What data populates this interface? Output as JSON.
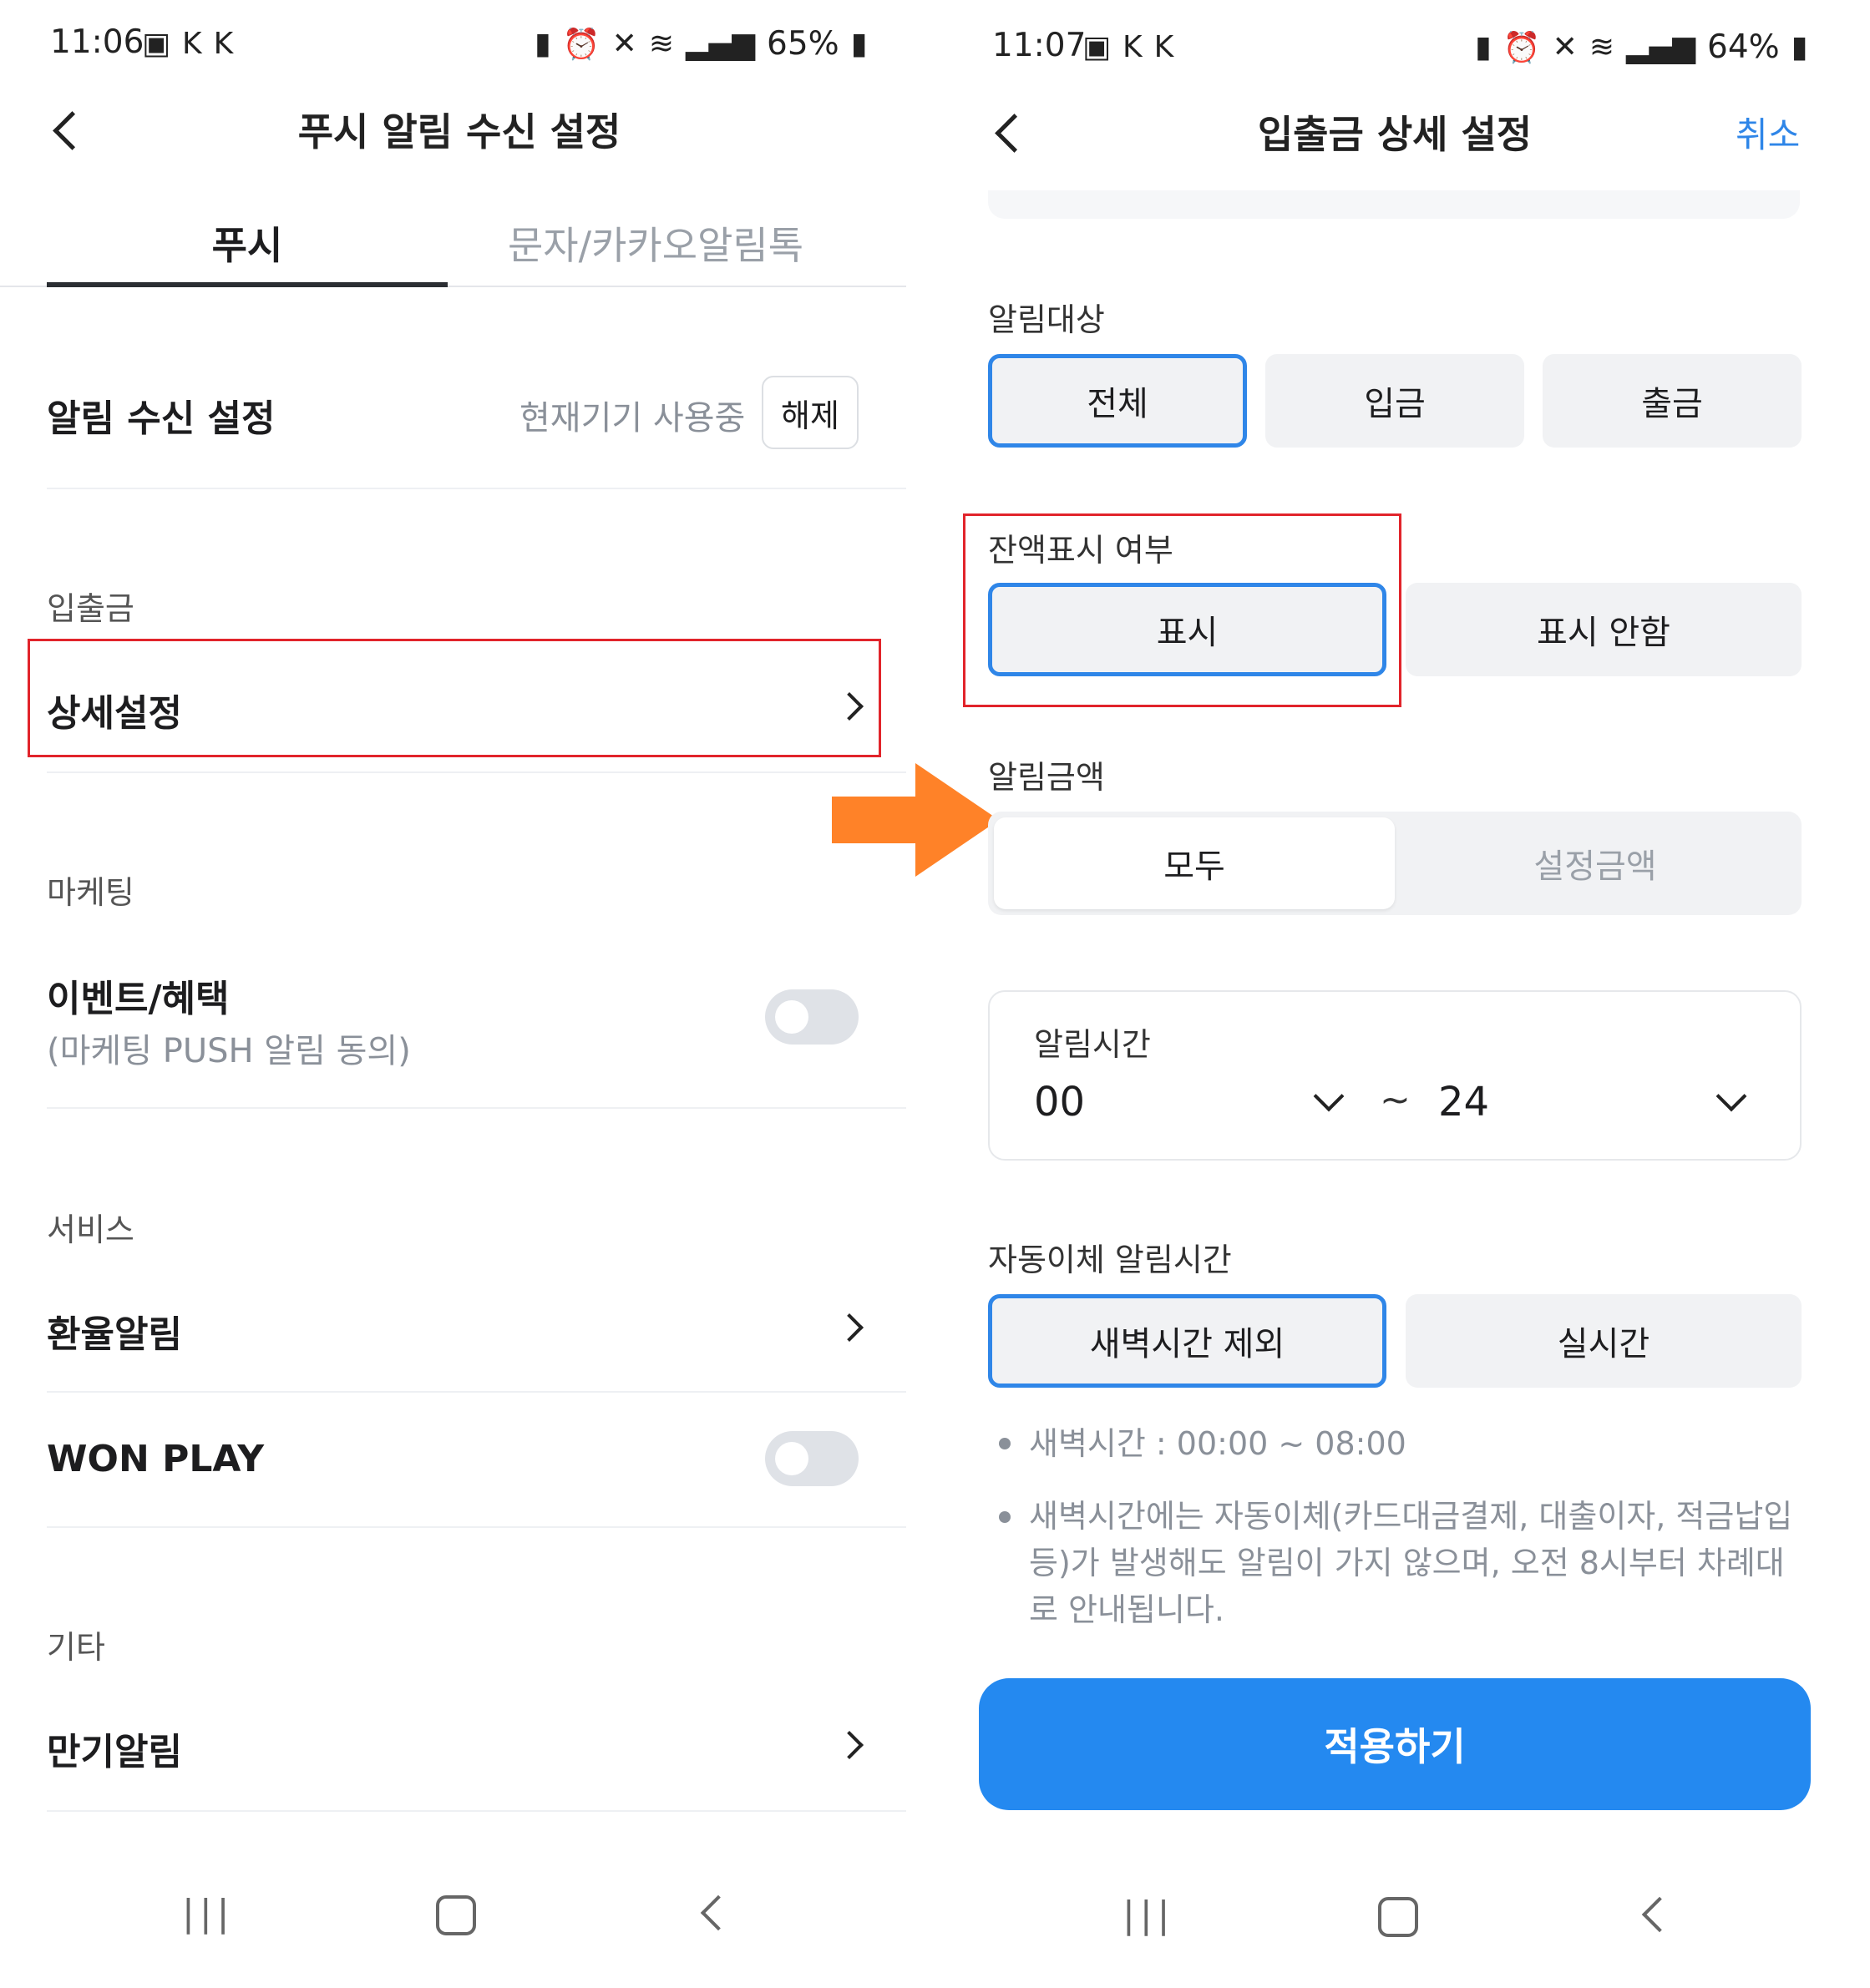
{
  "left": {
    "status": {
      "time": "11:06",
      "battery": "65%"
    },
    "header": {
      "title": "푸시 알림 수신 설정"
    },
    "tabs": [
      {
        "label": "푸시"
      },
      {
        "label": "문자/카카오알림톡"
      }
    ],
    "receive": {
      "label": "알림 수신 설정",
      "device_status": "현재기기 사용중",
      "release_button": "해제"
    },
    "deposit_section": {
      "label": "입출금",
      "detail": "상세설정"
    },
    "marketing_section": {
      "label": "마케팅",
      "event_title": "이벤트/혜택",
      "event_sub": "(마케팅 PUSH 알림 동의)"
    },
    "service_section": {
      "label": "서비스",
      "exchange": "환율알림",
      "wonplay": "WON PLAY"
    },
    "etc_section": {
      "label": "기타",
      "maturity": "만기알림"
    }
  },
  "right": {
    "status": {
      "time": "11:07",
      "battery": "64%"
    },
    "header": {
      "title": "입출금 상세 설정",
      "cancel": "취소"
    },
    "target": {
      "label": "알림대상",
      "options": [
        "전체",
        "입금",
        "출금"
      ],
      "selected": "전체"
    },
    "balance": {
      "label": "잔액표시 여부",
      "options": [
        "표시",
        "표시 안함"
      ],
      "selected": "표시"
    },
    "amount": {
      "label": "알림금액",
      "options": [
        "모두",
        "설정금액"
      ],
      "selected": "모두"
    },
    "time": {
      "label": "알림시간",
      "from": "00",
      "tilde": "~",
      "to": "24"
    },
    "auto": {
      "label": "자동이체 알림시간",
      "options": [
        "새벽시간 제외",
        "실시간"
      ],
      "selected": "새벽시간 제외"
    },
    "notes": [
      "새벽시간 : 00:00 ~ 08:00",
      "새벽시간에는 자동이체(카드대금결제, 대출이자, 적금납입 등)가 발생해도 알림이 가지 않으며, 오전 8시부터 차례대로 안내됩니다."
    ],
    "apply_button": "적용하기"
  },
  "colors": {
    "accent": "#2f86e8",
    "apply_bg": "#2489f0",
    "highlight": "#e1242b",
    "arrow": "#ff8228"
  },
  "icons": [
    "back-arrow-icon",
    "chevron-right-icon",
    "chevron-down-icon",
    "recent-apps-icon",
    "home-icon",
    "nav-back-icon"
  ]
}
